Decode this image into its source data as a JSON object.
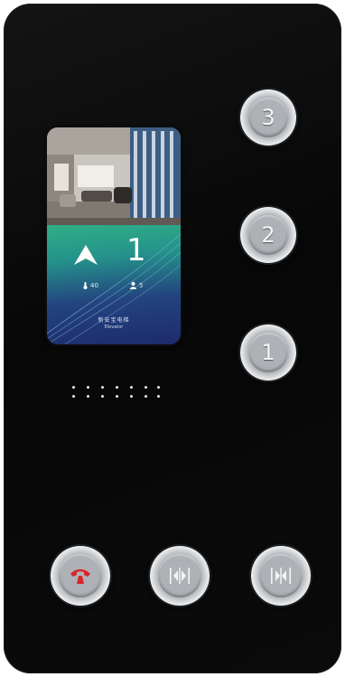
{
  "panel": {
    "background": "#0b0b0b"
  },
  "display": {
    "direction_icon": "up-arrow-icon",
    "floor": "1",
    "temperature": "40",
    "occupants": "5",
    "brand_line_1": "新安宝电梯",
    "brand_line_2": "Elevator",
    "colors": {
      "top": "#2fae86",
      "bottom": "#1d2b6c"
    }
  },
  "floor_buttons": [
    {
      "label": "3",
      "icon": "floor-3-button"
    },
    {
      "label": "2",
      "icon": "floor-2-button"
    },
    {
      "label": "1",
      "icon": "floor-1-button"
    }
  ],
  "bottom_buttons": [
    {
      "icon": "alarm-phone-icon",
      "color": "#d9262c"
    },
    {
      "icon": "door-open-icon"
    },
    {
      "icon": "door-close-icon"
    }
  ]
}
